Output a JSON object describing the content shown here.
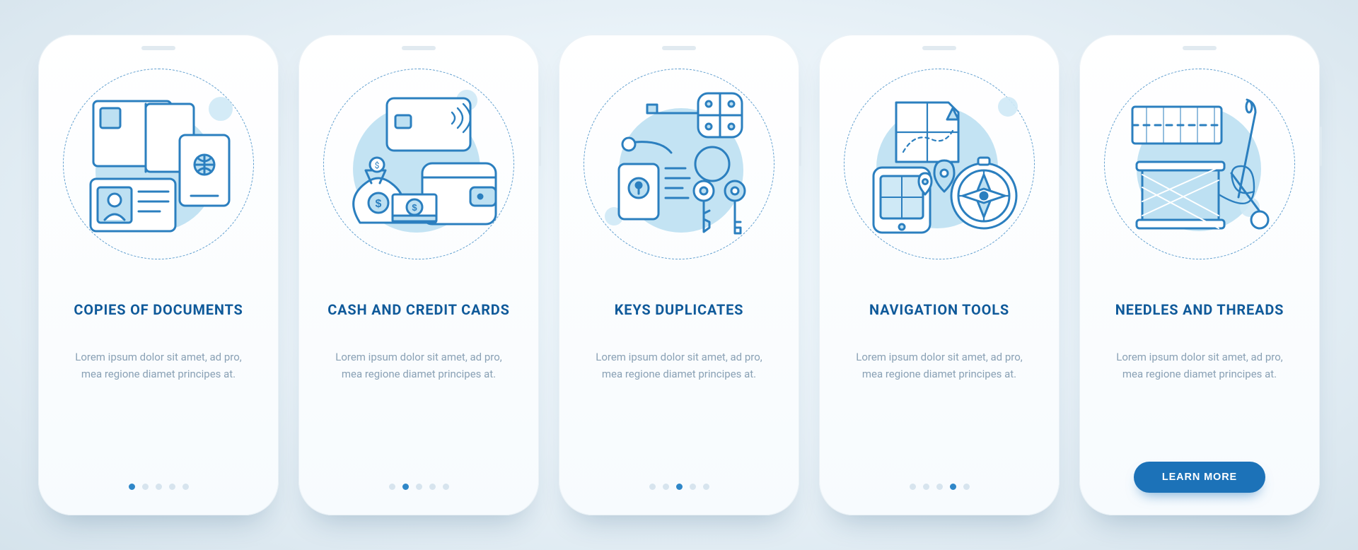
{
  "colors": {
    "stroke": "#2b7fbf",
    "title": "#0f5a9a",
    "body": "#8aa1b5",
    "accent": "#bde0f2",
    "button": "#1c72b8"
  },
  "slides": [
    {
      "icon": "documents-icon",
      "title": "COPIES OF DOCUMENTS",
      "desc": "Lorem ipsum dolor sit amet, ad pro, mea regione diamet principes at.",
      "activeDot": 0,
      "hasButton": false
    },
    {
      "icon": "cash-cards-icon",
      "title": "CASH AND CREDIT CARDS",
      "desc": "Lorem ipsum dolor sit amet, ad pro, mea regione diamet principes at.",
      "activeDot": 1,
      "hasButton": false
    },
    {
      "icon": "keys-icon",
      "title": "KEYS DUPLICATES",
      "desc": "Lorem ipsum dolor sit amet, ad pro, mea regione diamet principes at.",
      "activeDot": 2,
      "hasButton": false
    },
    {
      "icon": "navigation-icon",
      "title": "NAVIGATION TOOLS",
      "desc": "Lorem ipsum dolor sit amet, ad pro, mea regione diamet principes at.",
      "activeDot": 3,
      "hasButton": false
    },
    {
      "icon": "needle-thread-icon",
      "title": "NEEDLES AND THREADS",
      "desc": "Lorem ipsum dolor sit amet, ad pro, mea regione diamet principes at.",
      "activeDot": 4,
      "hasButton": true
    }
  ],
  "cta": {
    "label": "LEARN MORE"
  },
  "dotCount": 5
}
